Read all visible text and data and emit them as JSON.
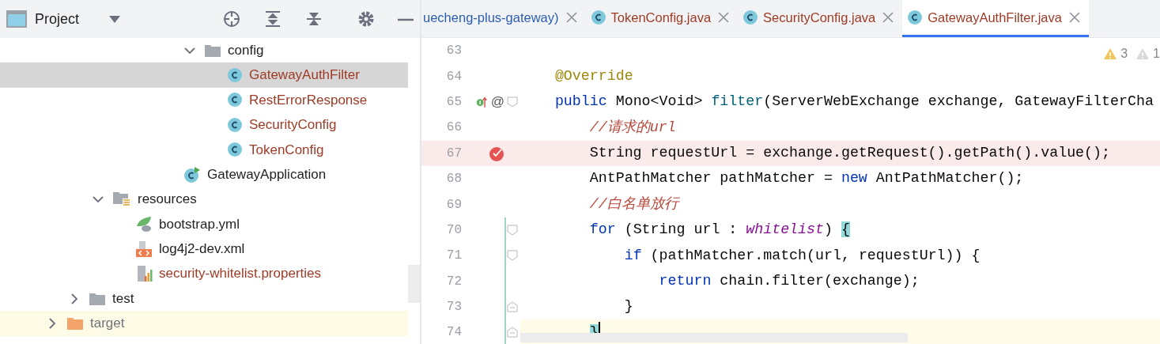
{
  "project_panel": {
    "title": "Project",
    "tree": [
      {
        "label": "config",
        "kind": "folder",
        "expanded": true,
        "color": "#1f1f1f",
        "selected": false,
        "children": [
          {
            "label": "GatewayAuthFilter",
            "kind": "class",
            "color": "#9e3a26",
            "selected": true
          },
          {
            "label": "RestErrorResponse",
            "kind": "class",
            "color": "#9e3a26",
            "selected": false
          },
          {
            "label": "SecurityConfig",
            "kind": "class",
            "color": "#9e3a26",
            "selected": false
          },
          {
            "label": "TokenConfig",
            "kind": "class",
            "color": "#9e3a26",
            "selected": false
          }
        ]
      },
      {
        "label": "GatewayApplication",
        "kind": "app",
        "color": "#1f1f1f",
        "selected": false
      },
      {
        "label": "resources",
        "kind": "resources",
        "expanded": true,
        "color": "#1f1f1f",
        "selected": false,
        "children": [
          {
            "label": "bootstrap.yml",
            "kind": "yml",
            "color": "#1f1f1f",
            "selected": false
          },
          {
            "label": "log4j2-dev.xml",
            "kind": "xml",
            "color": "#1f1f1f",
            "selected": false
          },
          {
            "label": "security-whitelist.properties",
            "kind": "properties",
            "color": "#9e3a26",
            "selected": false
          }
        ]
      },
      {
        "label": "test",
        "kind": "folder",
        "expanded": false,
        "color": "#1f1f1f",
        "selected": false
      },
      {
        "label": "target",
        "kind": "excluded",
        "expanded": false,
        "color": "#6f737a",
        "excluded": true,
        "selected": false
      }
    ]
  },
  "editor": {
    "tabs": [
      {
        "label": "uecheng-plus-gateway)",
        "kind": "plain",
        "color": "#2a5db0",
        "selected": false
      },
      {
        "label": "TokenConfig.java",
        "kind": "class",
        "color": "#9e3a26",
        "selected": false
      },
      {
        "label": "SecurityConfig.java",
        "kind": "class",
        "color": "#9e3a26",
        "selected": false
      },
      {
        "label": "GatewayAuthFilter.java",
        "kind": "class",
        "color": "#9e3a26",
        "selected": true
      }
    ],
    "inspections": [
      {
        "kind": "warning",
        "count": "3"
      },
      {
        "kind": "weak-warning",
        "count": "1"
      }
    ],
    "lines": [
      {
        "number": "63"
      },
      {
        "number": "64",
        "tokens": [
          {
            "kind": "annotation",
            "text": "    @Override"
          }
        ]
      },
      {
        "number": "65",
        "implements": true,
        "gutter_text": "@",
        "fold_start": true,
        "tokens": [
          {
            "kind": "keyword",
            "text": "    public"
          },
          {
            "kind": "plain",
            "text": " Mono<Void> "
          },
          {
            "kind": "method",
            "text": "filter"
          },
          {
            "kind": "plain",
            "text": "(ServerWebExchange exchange, GatewayFilterCha"
          }
        ]
      },
      {
        "number": "66",
        "tokens": [
          {
            "kind": "comment",
            "text": "        //请求的url"
          }
        ]
      },
      {
        "number": "67",
        "breakpoint": true,
        "tokens": [
          {
            "kind": "plain",
            "text": "        String requestUrl = exchange.getRequest().getPath().value();"
          }
        ]
      },
      {
        "number": "68",
        "tokens": [
          {
            "kind": "plain",
            "text": "        AntPathMatcher pathMatcher = "
          },
          {
            "kind": "keyword",
            "text": "new"
          },
          {
            "kind": "plain",
            "text": " AntPathMatcher();"
          }
        ]
      },
      {
        "number": "69",
        "tokens": [
          {
            "kind": "comment",
            "text": "        //白名单放行"
          }
        ]
      },
      {
        "number": "70",
        "fold_start": true,
        "changed": true,
        "tokens": [
          {
            "kind": "keyword",
            "text": "        for"
          },
          {
            "kind": "plain",
            "text": " (String url : "
          },
          {
            "kind": "field",
            "text": "whitelist"
          },
          {
            "kind": "plain",
            "text": ") "
          },
          {
            "kind": "plain",
            "text": "{",
            "match": true
          }
        ]
      },
      {
        "number": "71",
        "fold_start": true,
        "changed": true,
        "tokens": [
          {
            "kind": "keyword",
            "text": "            if"
          },
          {
            "kind": "plain",
            "text": " (pathMatcher.match(url, requestUrl)) {"
          }
        ]
      },
      {
        "number": "72",
        "changed": true,
        "tokens": [
          {
            "kind": "keyword",
            "text": "                return"
          },
          {
            "kind": "plain",
            "text": " chain.filter(exchange);"
          }
        ]
      },
      {
        "number": "73",
        "fold_end": true,
        "changed": true,
        "tokens": [
          {
            "kind": "plain",
            "text": "            }"
          }
        ]
      },
      {
        "number": "74",
        "fold_end": true,
        "changed": true,
        "current": true,
        "tokens": [
          {
            "kind": "plain",
            "text": "        }",
            "match": true
          }
        ]
      }
    ]
  }
}
